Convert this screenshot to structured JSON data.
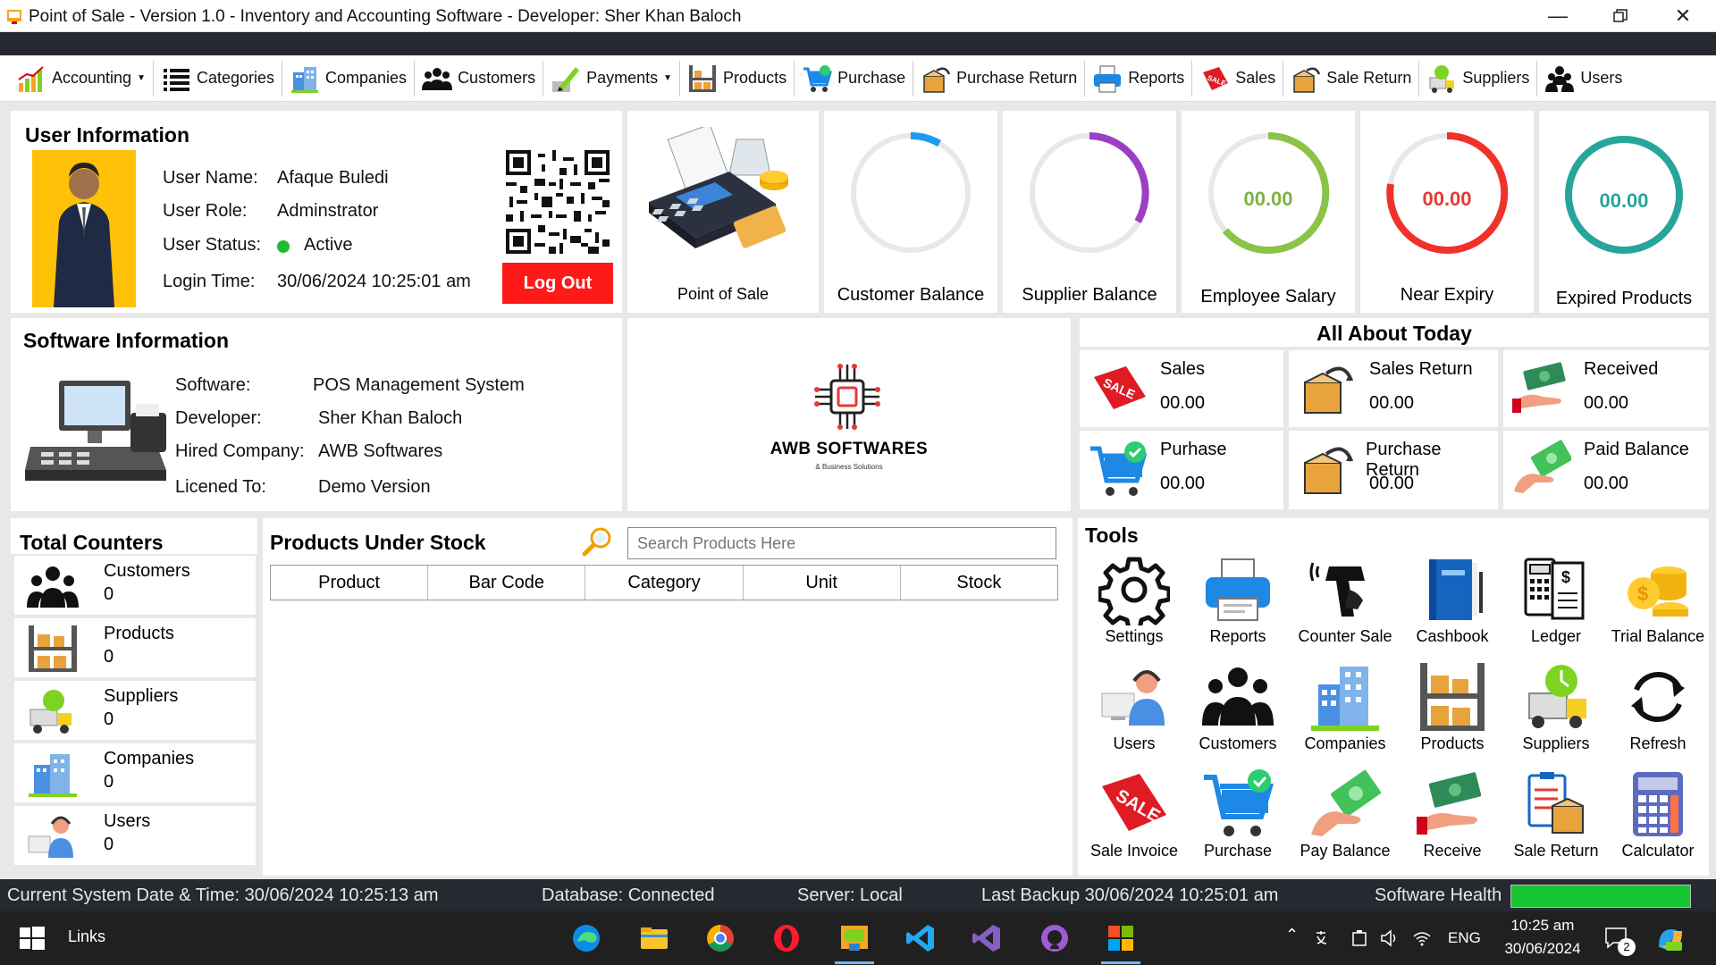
{
  "window": {
    "title": "Point of Sale - Version 1.0 - Inventory and Accounting Software - Developer: Sher Khan Baloch"
  },
  "menu": {
    "items": [
      {
        "label": "Accounting",
        "icon": "chart-icon",
        "dropdown": true
      },
      {
        "label": "Categories",
        "icon": "list-icon",
        "dropdown": false
      },
      {
        "label": "Companies",
        "icon": "building-icon",
        "dropdown": false
      },
      {
        "label": "Customers",
        "icon": "people-icon",
        "dropdown": false
      },
      {
        "label": "Payments",
        "icon": "pen-icon",
        "dropdown": true
      },
      {
        "label": "Products",
        "icon": "shelf-icon",
        "dropdown": false
      },
      {
        "label": "Purchase",
        "icon": "cart-icon",
        "dropdown": false
      },
      {
        "label": "Purchase Return",
        "icon": "box-return-icon",
        "dropdown": false
      },
      {
        "label": "Reports",
        "icon": "printer-icon",
        "dropdown": false
      },
      {
        "label": "Sales",
        "icon": "sale-tag-icon",
        "dropdown": false
      },
      {
        "label": "Sale Return",
        "icon": "box-return-icon",
        "dropdown": false
      },
      {
        "label": "Suppliers",
        "icon": "supplier-icon",
        "dropdown": false
      },
      {
        "label": "Users",
        "icon": "users-icon",
        "dropdown": false
      }
    ]
  },
  "user_info": {
    "heading": "User Information",
    "name_label": "User Name:",
    "name": "Afaque Buledi",
    "role_label": "User Role:",
    "role": "Adminstrator",
    "status_label": "User Status:",
    "status": "Active",
    "status_color": "#22bb33",
    "login_label": "Login Time:",
    "login": "30/06/2024 10:25:01 am",
    "logout": "Log Out"
  },
  "cards": {
    "pos": "Point of Sale",
    "customer_balance": "Customer Balance",
    "supplier_balance": "Supplier Balance",
    "employee_salary": "Employee Salary",
    "employee_salary_value": "00.00",
    "near_expiry": "Near Expiry",
    "near_expiry_value": "00.00",
    "expired_products": "Expired Products",
    "expired_products_value": "00.00"
  },
  "software_info": {
    "heading": "Software Information",
    "software_label": "Software:",
    "software": "POS Management System",
    "developer_label": "Developer:",
    "developer": "Sher Khan Baloch",
    "company_label": "Hired Company:",
    "company": "AWB Softwares",
    "licensed_label": "Licened To:",
    "licensed": "Demo Version"
  },
  "logo": {
    "name": "AWB SOFTWARES",
    "tagline": "& Business Solutions"
  },
  "today": {
    "heading": "All About Today",
    "cells": [
      {
        "label": "Sales",
        "value": "00.00"
      },
      {
        "label": "Sales Return",
        "value": "00.00"
      },
      {
        "label": "Received",
        "value": "00.00"
      },
      {
        "label": "Purhase",
        "value": "00.00"
      },
      {
        "label": "Purchase Return",
        "value": "00.00"
      },
      {
        "label": "Paid Balance",
        "value": "00.00"
      }
    ]
  },
  "counters": {
    "heading": "Total Counters",
    "items": [
      {
        "label": "Customers",
        "value": "0"
      },
      {
        "label": "Products",
        "value": "0"
      },
      {
        "label": "Suppliers",
        "value": "0"
      },
      {
        "label": "Companies",
        "value": "0"
      },
      {
        "label": "Users",
        "value": "0"
      }
    ]
  },
  "stock": {
    "heading": "Products Under Stock",
    "search_placeholder": "Search Products Here",
    "columns": [
      "Product",
      "Bar Code",
      "Category",
      "Unit",
      "Stock"
    ]
  },
  "tools": {
    "heading": "Tools",
    "items": [
      "Settings",
      "Reports",
      "Counter Sale",
      "Cashbook",
      "Ledger",
      "Trial Balance",
      "Users",
      "Customers",
      "Companies",
      "Products",
      "Suppliers",
      "Refresh",
      "Sale Invoice",
      "Purchase",
      "Pay Balance",
      "Receive",
      "Sale Return",
      "Calculator"
    ]
  },
  "status": {
    "datetime": "Current System Date & Time: 30/06/2024 10:25:13 am",
    "database": "Database: Connected",
    "server": "Server: Local",
    "backup": "Last Backup 30/06/2024 10:25:01 am",
    "health": "Software Health",
    "health_level": 1.0,
    "health_color": "#17c631"
  },
  "taskbar": {
    "links": "Links",
    "lang": "ENG",
    "time": "10:25 am",
    "date": "30/06/2024",
    "notifications": "2"
  }
}
